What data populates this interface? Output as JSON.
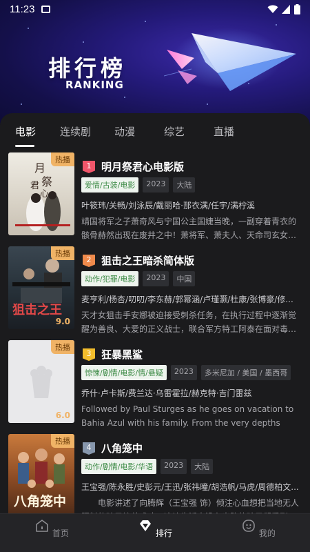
{
  "status": {
    "time": "11:23"
  },
  "hero": {
    "title": "排行榜",
    "subtitle": "RANKING"
  },
  "tabs": [
    {
      "label": "电影"
    },
    {
      "label": "连续剧"
    },
    {
      "label": "动漫"
    },
    {
      "label": "综艺"
    },
    {
      "label": "直播"
    }
  ],
  "items": [
    {
      "rank": "1",
      "rank_color": "#f0566a",
      "title": "明月祭君心电影版",
      "hot": "热播",
      "score": "",
      "tags": [
        "爱情/古装/电影",
        "2023",
        "大陆"
      ],
      "cast": "叶筱玮/关畅/刘泳辰/戴丽哈·那衣满/任宇/满柠溪",
      "desc": "靖国将军之子萧奇风与宁国公主国婕当晚，一副穿着青衣的骸骨赫然出现在废井之中！萧将军、萧夫人、天命司玄女素..."
    },
    {
      "rank": "2",
      "rank_color": "#f08a4b",
      "title": "狙击之王暗杀简体版",
      "hot": "热播",
      "score": "9.0",
      "tags": [
        "动作/犯罪/电影",
        "2023",
        "中国"
      ],
      "cast": "麦亨利/杨杏/叨叨/李东赫/郭幂涵/卢瑾灏/杜康/张博豪/修...",
      "desc": "天才女狙击手安娜被迫接受刺杀任务，在执行过程中逐渐觉醒为善良、大爱的正义战士，联合军方特工阿泰在面对毒枭..."
    },
    {
      "rank": "3",
      "rank_color": "#f2bd2c",
      "title": "狂暴黑鲨",
      "hot": "热播",
      "score": "6.0",
      "tags": [
        "惊悚/剧情/电影/情/悬疑",
        "2023",
        "多米尼加 / 美国 / 墨西哥"
      ],
      "cast": "乔什·卢卡斯/费兰达·乌雷霍拉/赫克特·吉门雷兹",
      "desc": "Followed by Paul Sturges as he goes on vacation to Bahia Azul with his family. From the very depths"
    },
    {
      "rank": "4",
      "rank_color": "#8797ad",
      "title": "八角笼中",
      "hot": "热播",
      "score": "",
      "tags": [
        "动作/剧情/电影/华语",
        "2023",
        "大陆"
      ],
      "cast": "王宝强/陈永胜/史彭元/王迅/张祎曈/胡浩帆/马虎/周德柏文...",
      "desc": "电影讲述了向腾辉（王宝强 饰）倾注心血想把当地无人照料的孩子培养成才，这让生活本没有出路的孩子们看到了..."
    }
  ],
  "bottom_nav": [
    {
      "label": "首页",
      "icon": "home-icon"
    },
    {
      "label": "排行",
      "icon": "ranking-icon"
    },
    {
      "label": "我的",
      "icon": "profile-icon"
    }
  ],
  "colors": {
    "background": "#1b1b1d",
    "genre_tag_bg": "#eef4ee",
    "genre_tag_text": "#3c8a45",
    "hot_badge": "#f0b366"
  }
}
